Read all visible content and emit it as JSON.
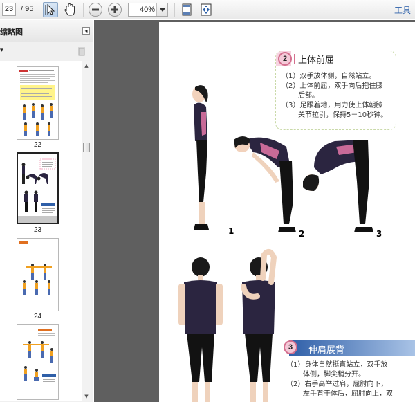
{
  "toolbar": {
    "current_page": "23",
    "total_pages": "/ 95",
    "zoom": "40%",
    "tools_label": "工具"
  },
  "sidebar": {
    "title": "缩略图",
    "thumbnails": [
      {
        "label": "22"
      },
      {
        "label": "23"
      },
      {
        "label": "24"
      },
      {
        "label": ""
      }
    ]
  },
  "document": {
    "section2": {
      "number": "2",
      "title": "上体前屈",
      "steps": [
        "（1）双手放体侧，自然站立。",
        "（2）上体前屈，双手向后抱住膝",
        "后部。",
        "（3）足跟着地，用力使上体朝膝",
        "关节拉引，保持5－10秒钟。"
      ]
    },
    "figure_labels": [
      "1",
      "2",
      "3"
    ],
    "section3": {
      "number": "3",
      "title": "伸肩展背",
      "steps": [
        "（1）身体自然挺直站立，双手放",
        "体侧，脚尖稍分开。",
        "（2）右手高举过肩，屈肘向下，",
        "左手背于体后，屈肘向上，双"
      ]
    }
  },
  "colors": {
    "badge_fill": "#f4c9d8",
    "badge_border": "#d4708f",
    "section3_bar": "#2f5fa8",
    "doc_background": "#5f5f5f",
    "tools_link": "#2a5ea8"
  }
}
